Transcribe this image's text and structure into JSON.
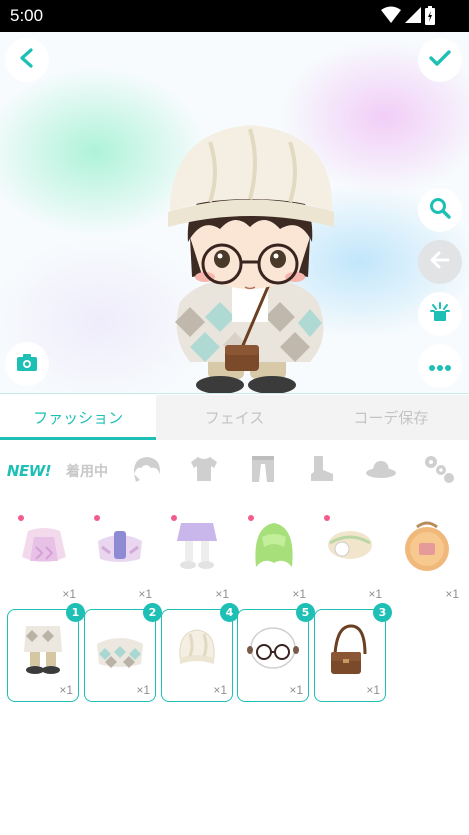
{
  "status_bar": {
    "time": "5:00",
    "icons": [
      "wifi-icon",
      "signal-icon",
      "battery-icon"
    ]
  },
  "toolbar": {
    "back_icon": "chevron-left-icon",
    "confirm_icon": "check-icon",
    "side_buttons": [
      "search-icon",
      "arrow-left-icon",
      "light-icon",
      "more-icon"
    ],
    "camera_icon": "camera-icon"
  },
  "tabs": [
    {
      "label": "ファッション",
      "active": true
    },
    {
      "label": "フェイス",
      "active": false
    },
    {
      "label": "コーデ保存",
      "active": false
    }
  ],
  "categories": {
    "new_label": "NEW!",
    "wearing_label": "着用中",
    "icons": [
      "hair-icon",
      "shirt-icon",
      "pants-icon",
      "boots-icon",
      "hat-icon",
      "accessory-icon"
    ]
  },
  "all_items": [
    {
      "name": "pink-dress",
      "qty": "×1",
      "is_new": true
    },
    {
      "name": "purple-jacket",
      "qty": "×1",
      "is_new": true
    },
    {
      "name": "lavender-skirt-boots",
      "qty": "×1",
      "is_new": true
    },
    {
      "name": "green-hair",
      "qty": "×1",
      "is_new": true
    },
    {
      "name": "cream-beret",
      "qty": "×1",
      "is_new": true
    },
    {
      "name": "cookie-bag",
      "qty": "×1",
      "is_new": false
    }
  ],
  "worn_items": [
    {
      "name": "argyle-outfit",
      "badge": "1",
      "qty": "×1"
    },
    {
      "name": "argyle-cape",
      "badge": "2",
      "qty": "×1"
    },
    {
      "name": "knit-beanie",
      "badge": "4",
      "qty": "×1"
    },
    {
      "name": "round-glasses",
      "badge": "5",
      "qty": "×1"
    },
    {
      "name": "brown-shoulder-bag",
      "badge": "3",
      "qty": "×1"
    }
  ],
  "colors": {
    "accent": "#1ebfb5",
    "new_dot": "#f25c8b",
    "inactive_tab_text": "#c4c4c4"
  }
}
